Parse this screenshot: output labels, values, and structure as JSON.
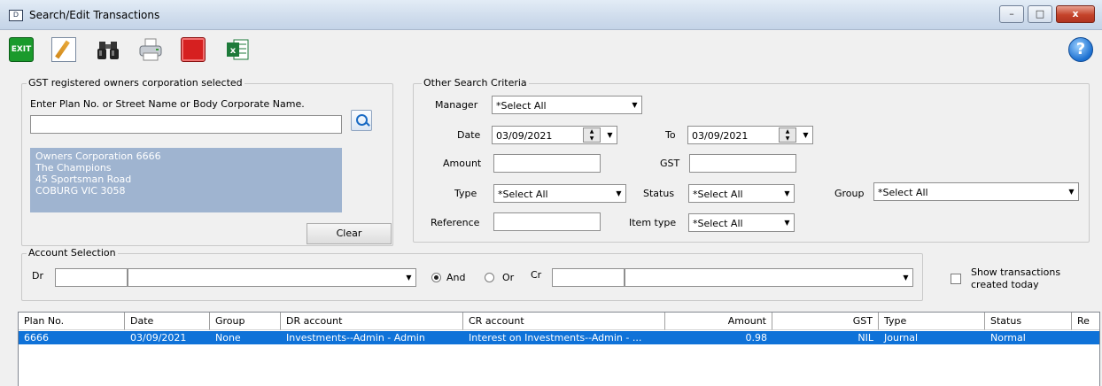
{
  "window": {
    "title": "Search/Edit Transactions",
    "icon": "app-window-icon",
    "min_glyph": "–",
    "max_glyph": "□",
    "close_glyph": "x"
  },
  "toolbar": {
    "exit_label": "EXIT",
    "icons": [
      "exit-icon",
      "edit-icon",
      "binoculars-icon",
      "printer-icon",
      "stop-icon",
      "excel-icon",
      "help-icon"
    ],
    "help_glyph": "?"
  },
  "gst_group": {
    "title": "GST registered owners corporation selected",
    "prompt": "Enter Plan No. or Street Name or Body Corporate Name.",
    "search_value": "",
    "owner_lines": [
      "Owners Corporation 6666",
      "The Champions",
      "45 Sportsman Road",
      "COBURG  VIC  3058"
    ],
    "clear_label": "Clear"
  },
  "criteria": {
    "title": "Other Search Criteria",
    "manager_label": "Manager",
    "manager_value": "*Select All",
    "date_label": "Date",
    "date_value": "03/09/2021",
    "to_label": "To",
    "to_value": "03/09/2021",
    "amount_label": "Amount",
    "amount_value": "",
    "gst_label": "GST",
    "gst_value": "",
    "type_label": "Type",
    "type_value": "*Select All",
    "status_label": "Status",
    "status_value": "*Select All",
    "group_label": "Group",
    "group_value": "*Select All",
    "reference_label": "Reference",
    "reference_value": "",
    "item_type_label": "Item type",
    "item_type_value": "*Select All"
  },
  "account": {
    "title": "Account Selection",
    "dr_label": "Dr",
    "dr_code": "",
    "dr_name": "",
    "and_label": "And",
    "or_label": "Or",
    "and_checked": true,
    "cr_label": "Cr",
    "cr_code": "",
    "cr_name": ""
  },
  "show_today": {
    "line1": "Show transactions",
    "line2": "created today",
    "checked": false
  },
  "grid": {
    "columns": [
      "Plan No.",
      "Date",
      "Group",
      "DR account",
      "CR account",
      "Amount",
      "GST",
      "Type",
      "Status",
      "Re"
    ],
    "rows": [
      [
        "6666",
        "03/09/2021",
        "None",
        "Investments--Admin - Admin",
        "Interest on Investments--Admin - ...",
        "0.98",
        "NIL",
        "Journal",
        "Normal",
        ""
      ]
    ],
    "selected_color": "#0f72d8"
  }
}
